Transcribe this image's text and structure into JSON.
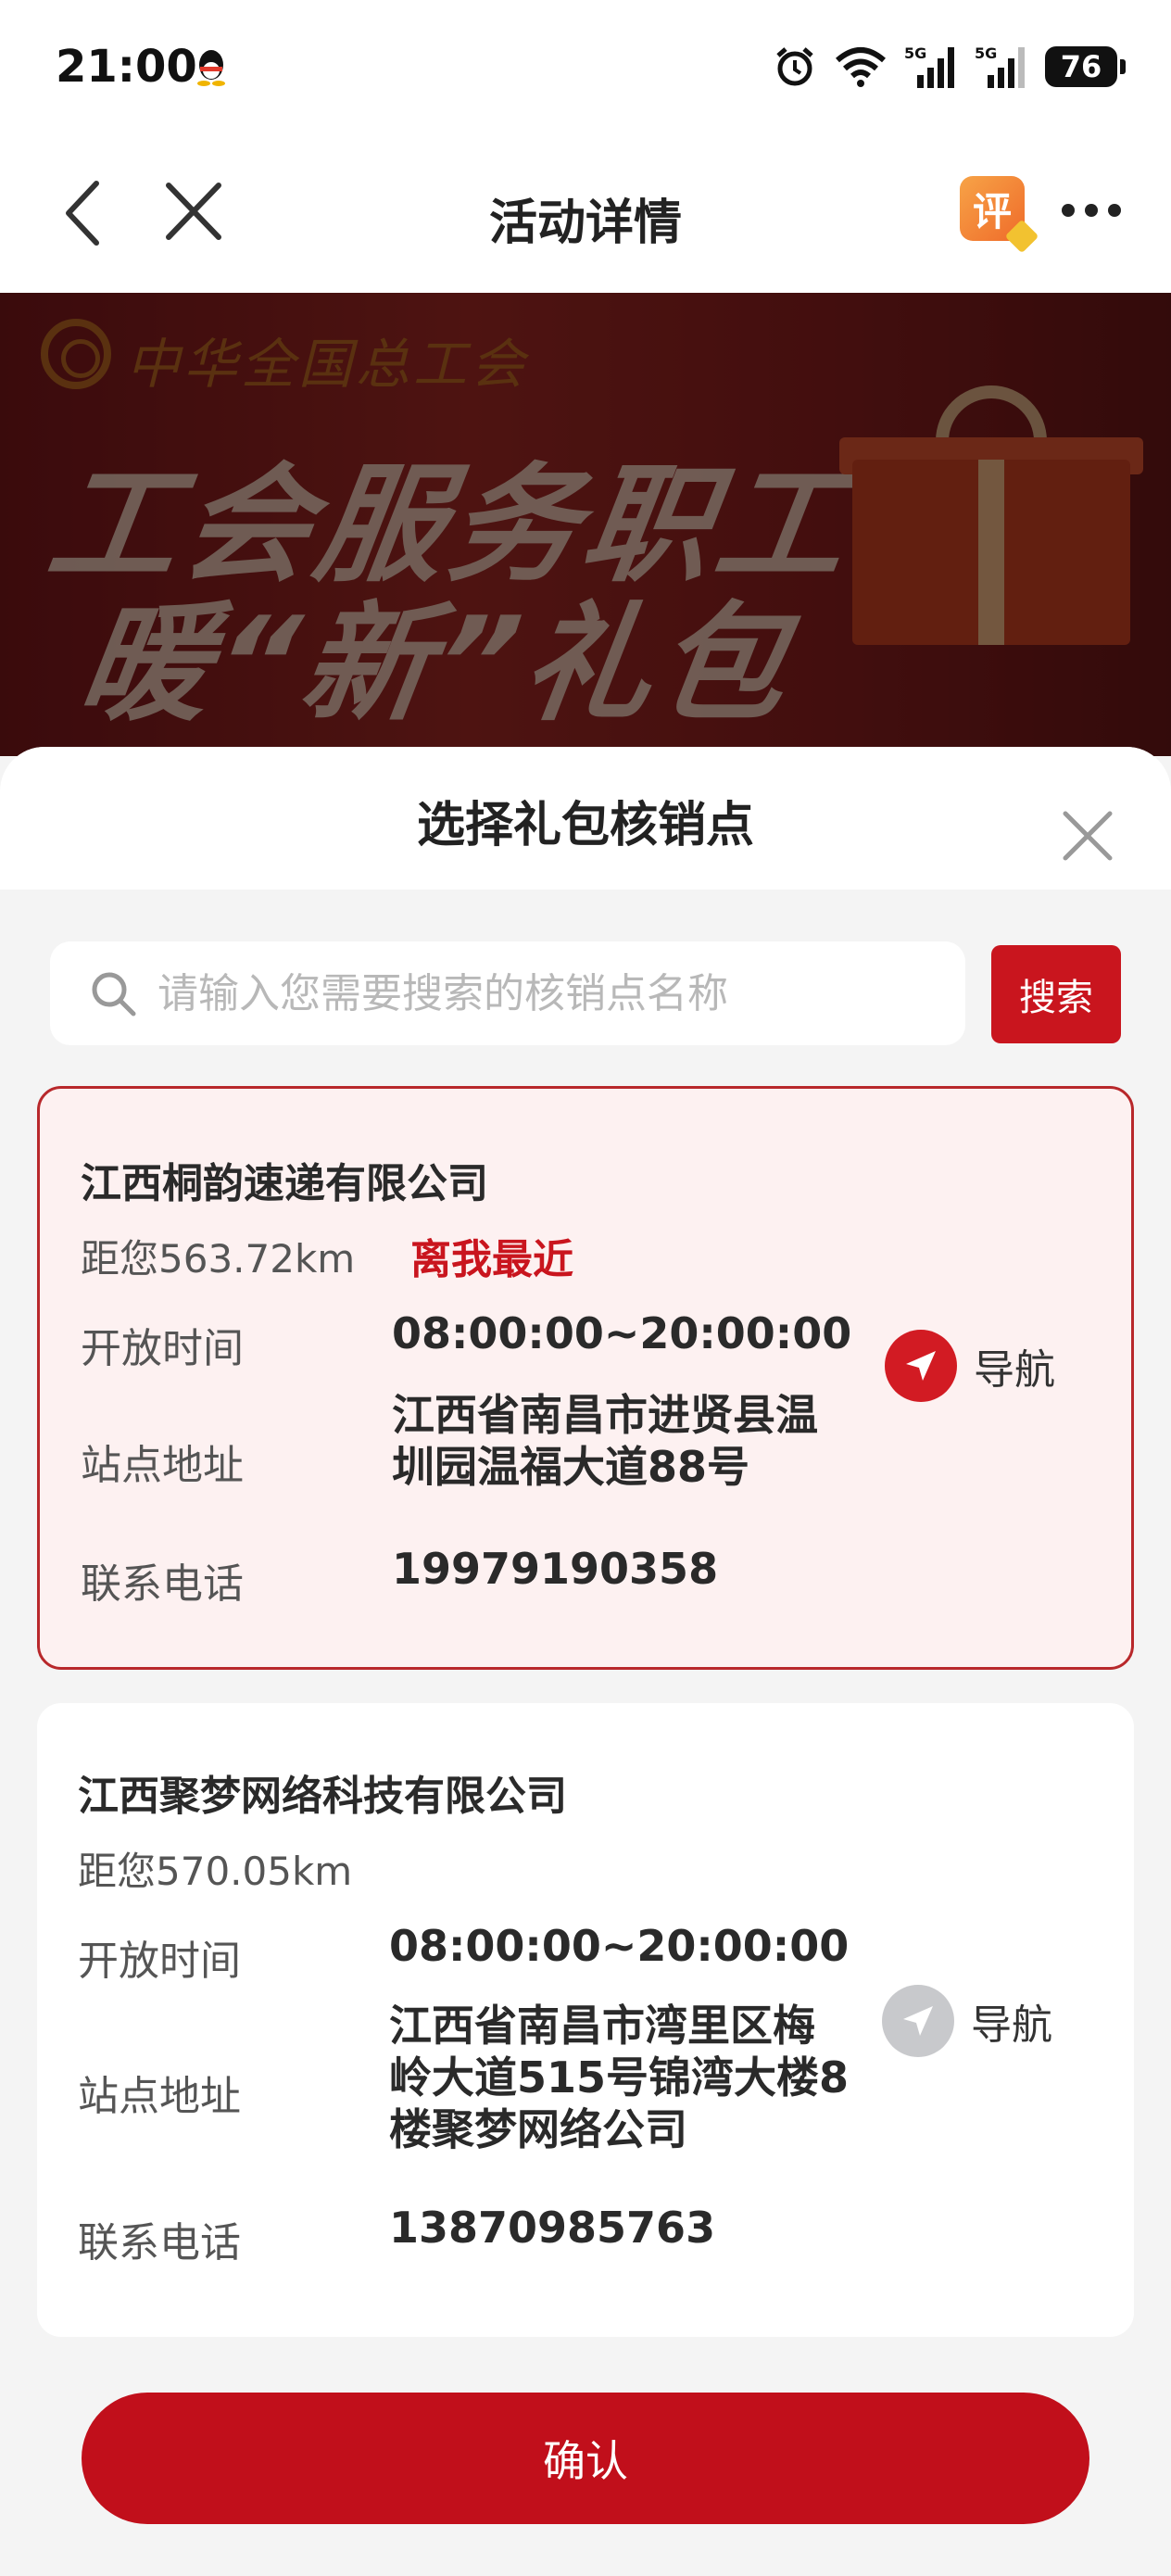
{
  "status_bar": {
    "time": "21:00",
    "battery": "76",
    "signal_1": "5G",
    "signal_2": "5G"
  },
  "nav": {
    "title": "活动详情",
    "rate_label": "评"
  },
  "banner": {
    "org_name": "中华全国总工会",
    "headline_1": "工会服务职工",
    "headline_2": "暖“新”礼包"
  },
  "sheet": {
    "title": "选择礼包核销点",
    "search": {
      "placeholder": "请输入您需要搜索的核销点名称",
      "value": "",
      "button": "搜索"
    },
    "labels": {
      "hours": "开放时间",
      "address": "站点地址",
      "phone": "联系电话",
      "navigate": "导航"
    },
    "points": [
      {
        "name": "江西桐韵速递有限公司",
        "distance": "距您563.72km",
        "badge": "离我最近",
        "hours": "08:00:00~20:00:00",
        "address": "江西省南昌市进贤县温圳园温福大道88号",
        "phone": "19979190358",
        "selected": true
      },
      {
        "name": "江西聚梦网络科技有限公司",
        "distance": "距您570.05km",
        "badge": "",
        "hours": "08:00:00~20:00:00",
        "address": "江西省南昌市湾里区梅岭大道515号锦湾大楼8楼聚梦网络公司",
        "phone": "13870985763",
        "selected": false
      }
    ],
    "confirm": "确认"
  },
  "colors": {
    "accent": "#c9151e",
    "selected_bg": "#fdf1f1",
    "nav_active": "#d21b23",
    "nav_inactive": "#c8c9cc"
  }
}
